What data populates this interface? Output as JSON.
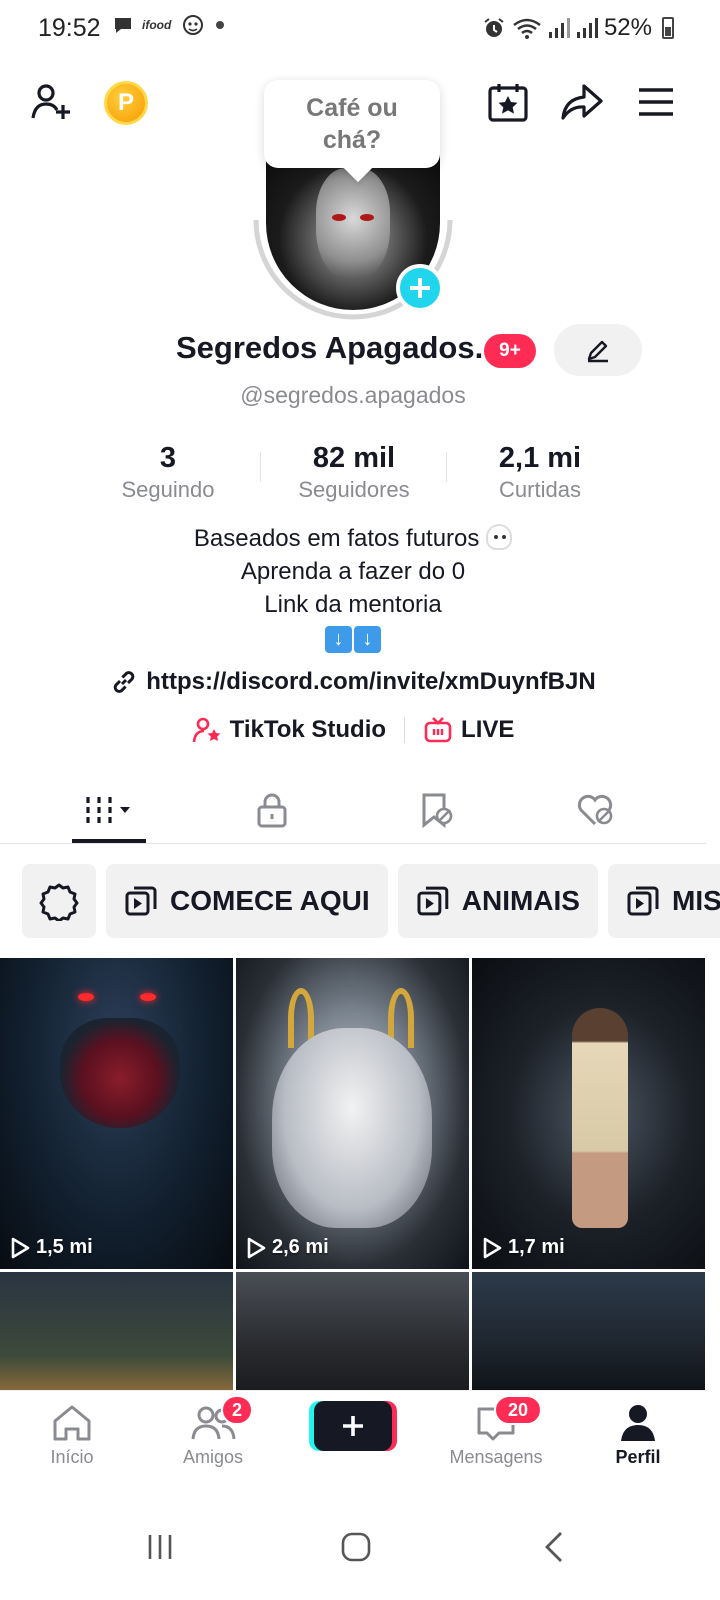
{
  "status_bar": {
    "time": "19:52",
    "battery": "52%",
    "icons_left": [
      "chat-icon",
      "ifood-icon",
      "mask-icon",
      "dot-icon"
    ],
    "icons_right": [
      "alarm-icon",
      "wifi-icon",
      "signal-icon",
      "signal-icon",
      "battery-icon"
    ]
  },
  "top_bar": {
    "bubble_text": "Café ou chá?",
    "coin_label": "P"
  },
  "profile": {
    "name": "Segredos Apagados.",
    "name_badge": "9+",
    "handle": "@segredos.apagados",
    "stats": {
      "following": {
        "value": "3",
        "label": "Seguindo"
      },
      "followers": {
        "value": "82 mil",
        "label": "Seguidores"
      },
      "likes": {
        "value": "2,1 mi",
        "label": "Curtidas"
      }
    },
    "bio_line1": "Baseados em fatos futuros",
    "bio_line2": "Aprenda a fazer do 0",
    "bio_line3": "Link da mentoria",
    "bio_arrow": "↓",
    "link": "https://discord.com/invite/xmDuynfBJN",
    "tool_studio": "TikTok Studio",
    "tool_live": "LIVE"
  },
  "tabs": [
    "videos-tab",
    "private-tab",
    "reposts-tab",
    "liked-tab"
  ],
  "playlists": {
    "comece": "COMECE AQUI",
    "animais": "ANIMAIS",
    "mis": "MIS"
  },
  "videos": [
    {
      "views": "1,5 mi"
    },
    {
      "views": "2,6 mi"
    },
    {
      "views": "1,7 mi"
    }
  ],
  "bottom_nav": {
    "home": "Início",
    "friends": "Amigos",
    "friends_badge": "2",
    "inbox": "Mensagens",
    "inbox_badge": "20",
    "profile": "Perfil"
  },
  "colors": {
    "accent_red": "#fe2c55",
    "accent_cyan": "#20d5ec",
    "text_primary": "#161823",
    "text_secondary": "#8a8b91"
  }
}
